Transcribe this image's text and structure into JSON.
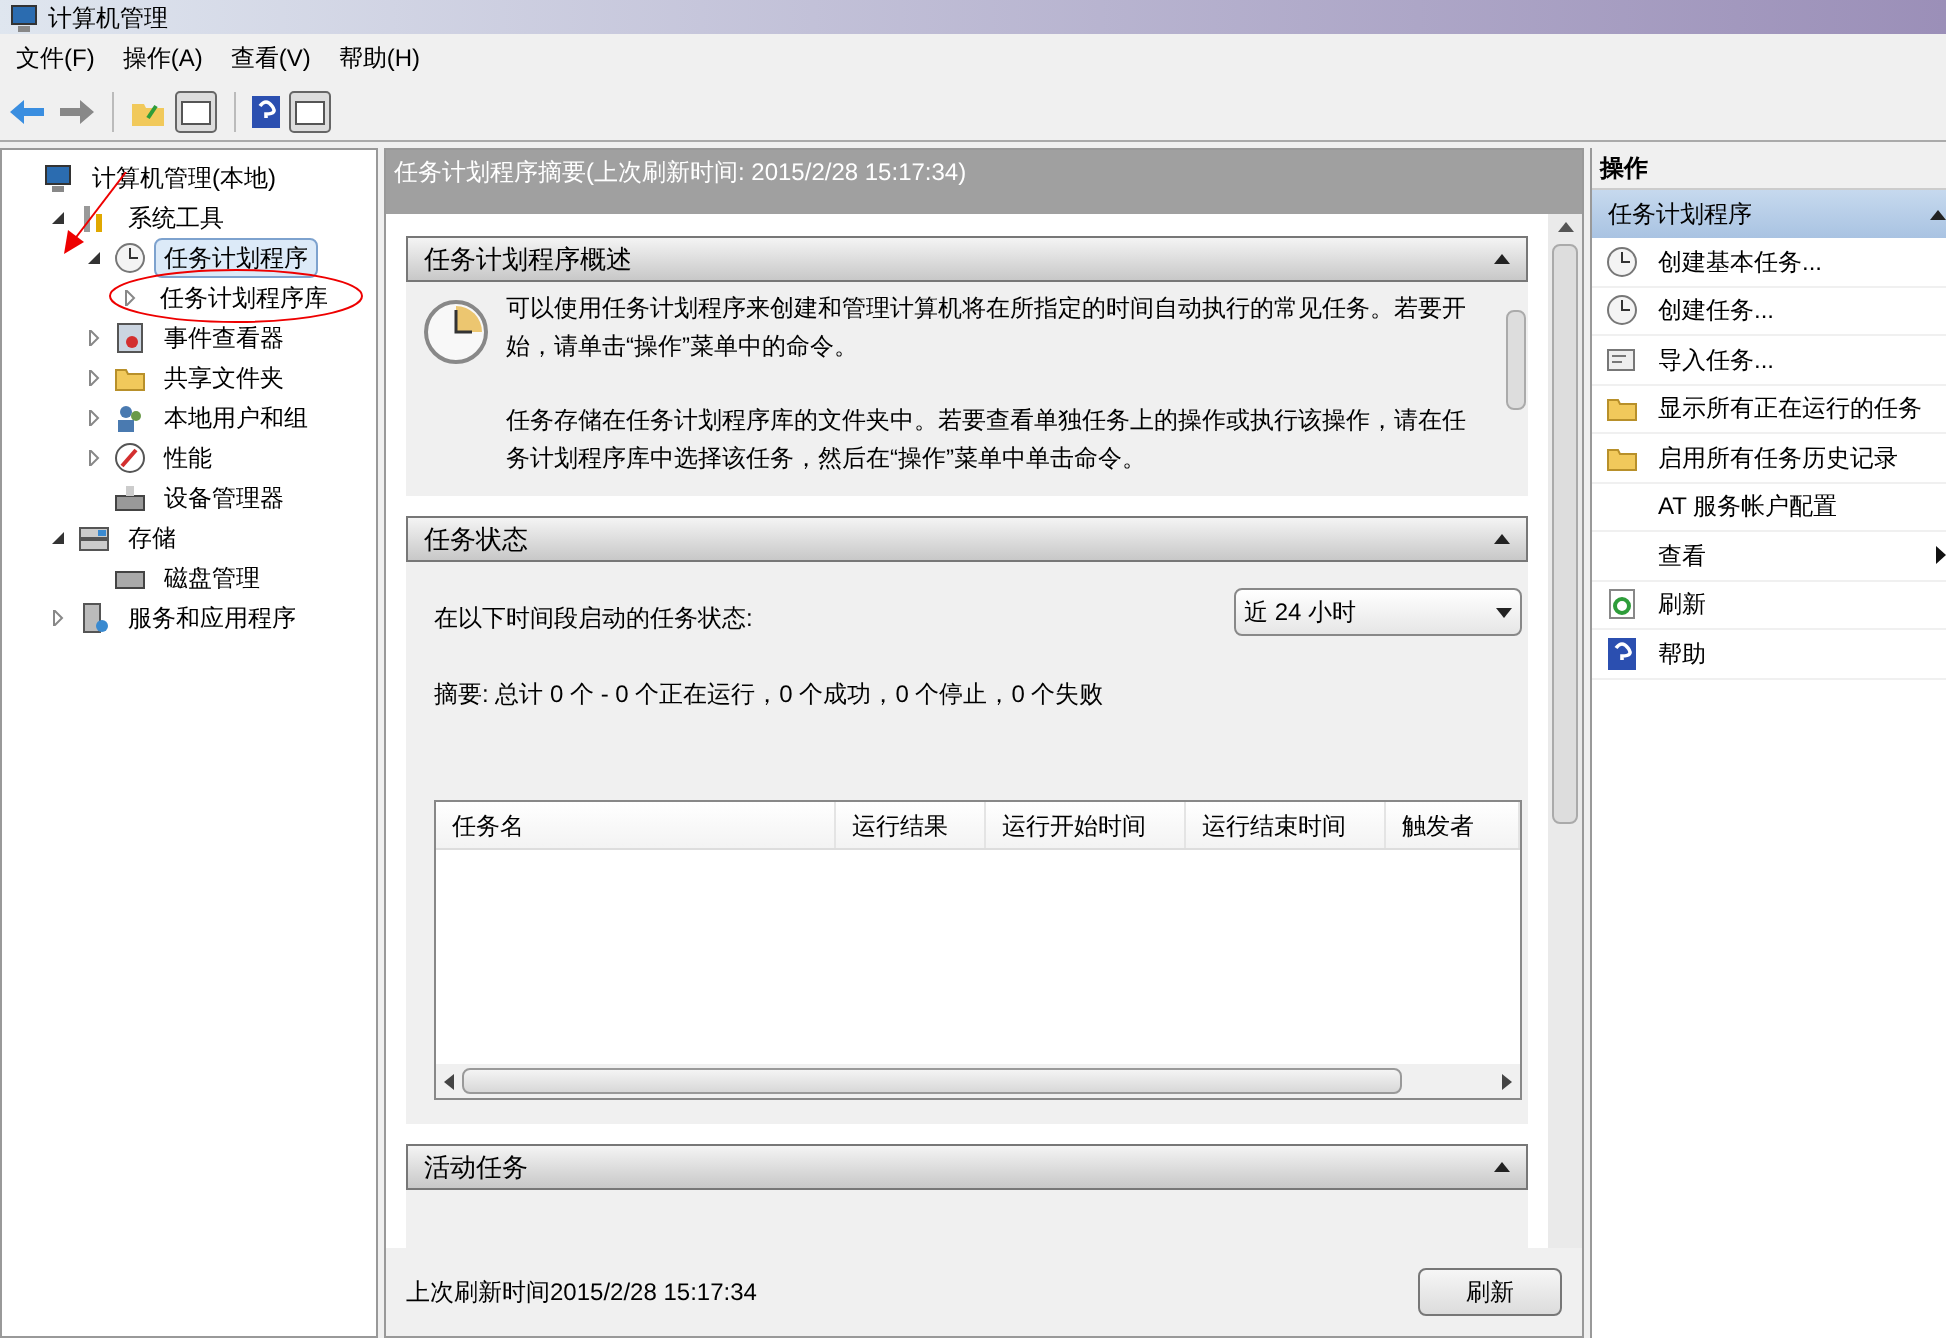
{
  "window": {
    "title": "计算机管理"
  },
  "menu": [
    "文件(F)",
    "操作(A)",
    "查看(V)",
    "帮助(H)"
  ],
  "tree": [
    {
      "label": "计算机管理(本地)",
      "selected": false,
      "children": [
        {
          "label": "系统工具",
          "expanded": true,
          "selected": false,
          "children": [
            {
              "label": "任务计划程序",
              "expanded": true,
              "selected": true,
              "children": [
                {
                  "label": "任务计划程序库",
                  "expanded": false,
                  "selected": false
                }
              ]
            },
            {
              "label": "事件查看器",
              "expanded": false,
              "selected": false
            },
            {
              "label": "共享文件夹",
              "expanded": false,
              "selected": false
            },
            {
              "label": "本地用户和组",
              "expanded": false,
              "selected": false
            },
            {
              "label": "性能",
              "expanded": false,
              "selected": false
            },
            {
              "label": "设备管理器",
              "selected": false
            }
          ]
        },
        {
          "label": "存储",
          "expanded": true,
          "selected": false,
          "children": [
            {
              "label": "磁盘管理",
              "selected": false
            }
          ]
        },
        {
          "label": "服务和应用程序",
          "expanded": false,
          "selected": false
        }
      ]
    }
  ],
  "summary_header": "任务计划程序摘要(上次刷新时间: 2015/2/28 15:17:34)",
  "overview": {
    "title": "任务计划程序概述",
    "paragraphs": [
      "可以使用任务计划程序来创建和管理计算机将在所指定的时间自动执行的常见任务。若要开始，请单击“操作”菜单中的命令。",
      "任务存储在任务计划程序库的文件夹中。若要查看单独任务上的操作或执行该操作，请在任务计划程序库中选择该任务，然后在“操作”菜单中单击命令。"
    ]
  },
  "task_status": {
    "title": "任务状态",
    "period_label": "在以下时间段启动的任务状态:",
    "period_value": "近 24 小时",
    "summary": "摘要: 总计 0 个 - 0 个正在运行，0 个成功，0 个停止，0 个失败",
    "table": {
      "columns": [
        "任务名",
        "运行结果",
        "运行开始时间",
        "运行结束时间",
        "触发者"
      ]
    }
  },
  "active_tasks": {
    "title": "活动任务"
  },
  "status_bar": {
    "text": "上次刷新时间2015/2/28 15:17:34",
    "button": "刷新"
  },
  "actions": {
    "title": "操作",
    "group": "任务计划程序",
    "items": [
      {
        "label": "创建基本任务...",
        "submenu": false
      },
      {
        "label": "创建任务...",
        "submenu": false
      },
      {
        "label": "导入任务...",
        "submenu": false
      },
      {
        "label": "显示所有正在运行的任务",
        "submenu": false
      },
      {
        "label": "启用所有任务历史记录",
        "submenu": false
      },
      {
        "label": "AT 服务帐户配置",
        "submenu": false
      },
      {
        "label": "查看",
        "submenu": true
      },
      {
        "label": "刷新",
        "submenu": false
      },
      {
        "label": "帮助",
        "submenu": false
      }
    ]
  }
}
